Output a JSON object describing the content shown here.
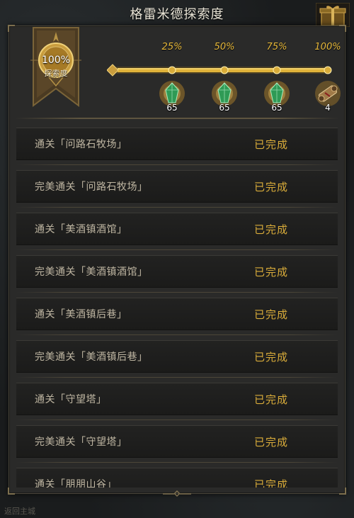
{
  "window": {
    "title": "格雷米德探索度"
  },
  "banner": {
    "percent": "100%",
    "label": "探索度"
  },
  "milestones": [
    {
      "percent": "25%",
      "reward_icon": "green-crystal-icon",
      "count": "65"
    },
    {
      "percent": "50%",
      "reward_icon": "green-crystal-icon",
      "count": "65"
    },
    {
      "percent": "75%",
      "reward_icon": "green-crystal-icon",
      "count": "65"
    },
    {
      "percent": "100%",
      "reward_icon": "scroll-icon",
      "count": "4"
    }
  ],
  "progress": {
    "value": 1.0
  },
  "tasks": [
    {
      "name": "通关「问路石牧场」",
      "status": "已完成"
    },
    {
      "name": "完美通关「问路石牧场」",
      "status": "已完成"
    },
    {
      "name": "通关「美酒镇酒馆」",
      "status": "已完成"
    },
    {
      "name": "完美通关「美酒镇酒馆」",
      "status": "已完成"
    },
    {
      "name": "通关「美酒镇后巷」",
      "status": "已完成"
    },
    {
      "name": "完美通关「美酒镇后巷」",
      "status": "已完成"
    },
    {
      "name": "通关「守望塔」",
      "status": "已完成"
    },
    {
      "name": "完美通关「守望塔」",
      "status": "已完成"
    },
    {
      "name": "通关「朋朋山谷」",
      "status": "已完成"
    }
  ],
  "footer": {
    "text": "返回主城"
  },
  "colors": {
    "accent_gold": "#d9ac3a",
    "panel_bg": "#2a2a29",
    "text_muted": "#bfb6a2"
  }
}
